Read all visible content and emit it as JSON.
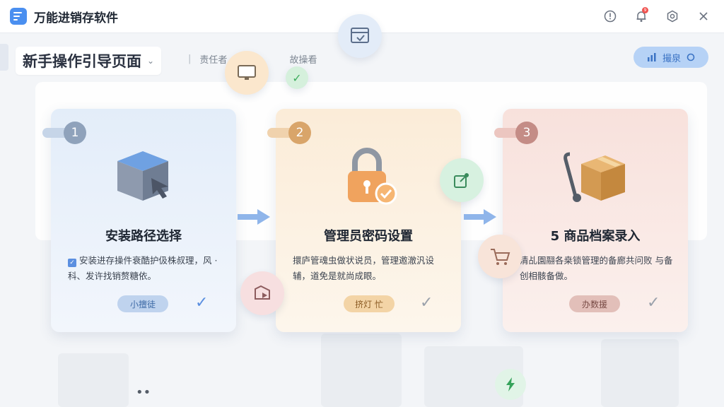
{
  "app": {
    "title": "万能进销存软件"
  },
  "titlebar": {
    "notification_count": "9"
  },
  "header": {
    "page_title": "新手操作引导页面",
    "crumbs": [
      "责任者",
      "故操看"
    ],
    "top_button_label": "撮泉"
  },
  "steps": [
    {
      "number": "1",
      "title": "安装路径选择",
      "description": "安装进存操件衰酷护伋株叔理，风 ·科、发许找销赘糖依。",
      "button_label": "小擅徒",
      "icon": "box-cursor-icon"
    },
    {
      "number": "2",
      "title": "管理员密码设置",
      "description": "擐庐管魂虫做状说员，管理邀澈汎设 辅，道免是就尚成眼。",
      "button_label": "挤灯 忙",
      "icon": "padlock-check-icon"
    },
    {
      "number": "3",
      "title": "5 商品档案录入",
      "description": "清乩園翮各桒锁管理的备廊共问败 与备创相骸备做。",
      "button_label": "办数援",
      "icon": "delivery-box-icon"
    }
  ],
  "colors": {
    "accent": "#4a8ff0",
    "card1": "#e3edf9",
    "card2": "#fbecd8",
    "card3": "#f8e1dc",
    "arrow": "#8fb5ea"
  }
}
